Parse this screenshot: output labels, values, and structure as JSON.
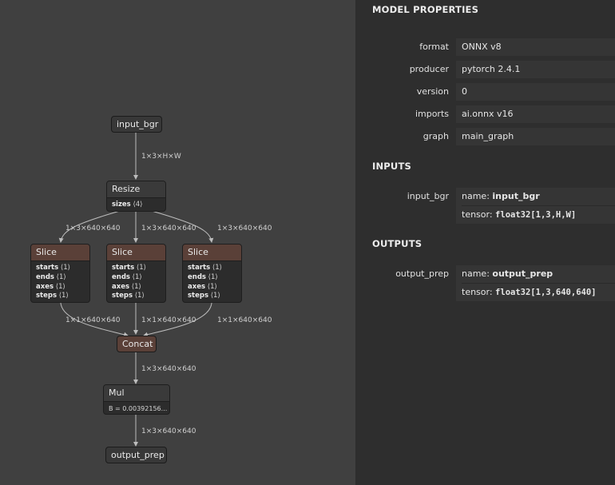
{
  "graph": {
    "nodes": {
      "input": "input_bgr",
      "resize": {
        "title": "Resize",
        "attr_name": "sizes",
        "attr_value": "⟨4⟩"
      },
      "slices": [
        {
          "title": "Slice",
          "attrs": [
            [
              "starts",
              "⟨1⟩"
            ],
            [
              "ends",
              "⟨1⟩"
            ],
            [
              "axes",
              "⟨1⟩"
            ],
            [
              "steps",
              "⟨1⟩"
            ]
          ]
        },
        {
          "title": "Slice",
          "attrs": [
            [
              "starts",
              "⟨1⟩"
            ],
            [
              "ends",
              "⟨1⟩"
            ],
            [
              "axes",
              "⟨1⟩"
            ],
            [
              "steps",
              "⟨1⟩"
            ]
          ]
        },
        {
          "title": "Slice",
          "attrs": [
            [
              "starts",
              "⟨1⟩"
            ],
            [
              "ends",
              "⟨1⟩"
            ],
            [
              "axes",
              "⟨1⟩"
            ],
            [
              "steps",
              "⟨1⟩"
            ]
          ]
        }
      ],
      "concat": "Concat",
      "mul": {
        "title": "Mul",
        "attr": "B = 0.00392156..."
      },
      "output": "output_prep"
    },
    "edges": {
      "input_to_resize": "1×3×H×W",
      "resize_to_slice": [
        "1×3×640×640",
        "1×3×640×640",
        "1×3×640×640"
      ],
      "slice_to_concat": [
        "1×1×640×640",
        "1×1×640×640",
        "1×1×640×640"
      ],
      "concat_to_mul": "1×3×640×640",
      "mul_to_output": "1×3×640×640"
    },
    "colors": {
      "slice_header": "#5a4038",
      "concat_fill": "#5a4038",
      "edge": "#bdbdbd"
    }
  },
  "panel": {
    "model_title": "MODEL PROPERTIES",
    "properties": [
      {
        "key": "format",
        "value": "ONNX v8"
      },
      {
        "key": "producer",
        "value": "pytorch 2.4.1"
      },
      {
        "key": "version",
        "value": "0"
      },
      {
        "key": "imports",
        "value": "ai.onnx v16"
      },
      {
        "key": "graph",
        "value": "main_graph"
      }
    ],
    "inputs_title": "INPUTS",
    "inputs": [
      {
        "key": "input_bgr",
        "name_label": "name: ",
        "name": "input_bgr",
        "tensor_label": "tensor: ",
        "tensor": "float32[1,3,H,W]"
      }
    ],
    "outputs_title": "OUTPUTS",
    "outputs": [
      {
        "key": "output_prep",
        "name_label": "name: ",
        "name": "output_prep",
        "tensor_label": "tensor: ",
        "tensor": "float32[1,3,640,640]"
      }
    ]
  }
}
